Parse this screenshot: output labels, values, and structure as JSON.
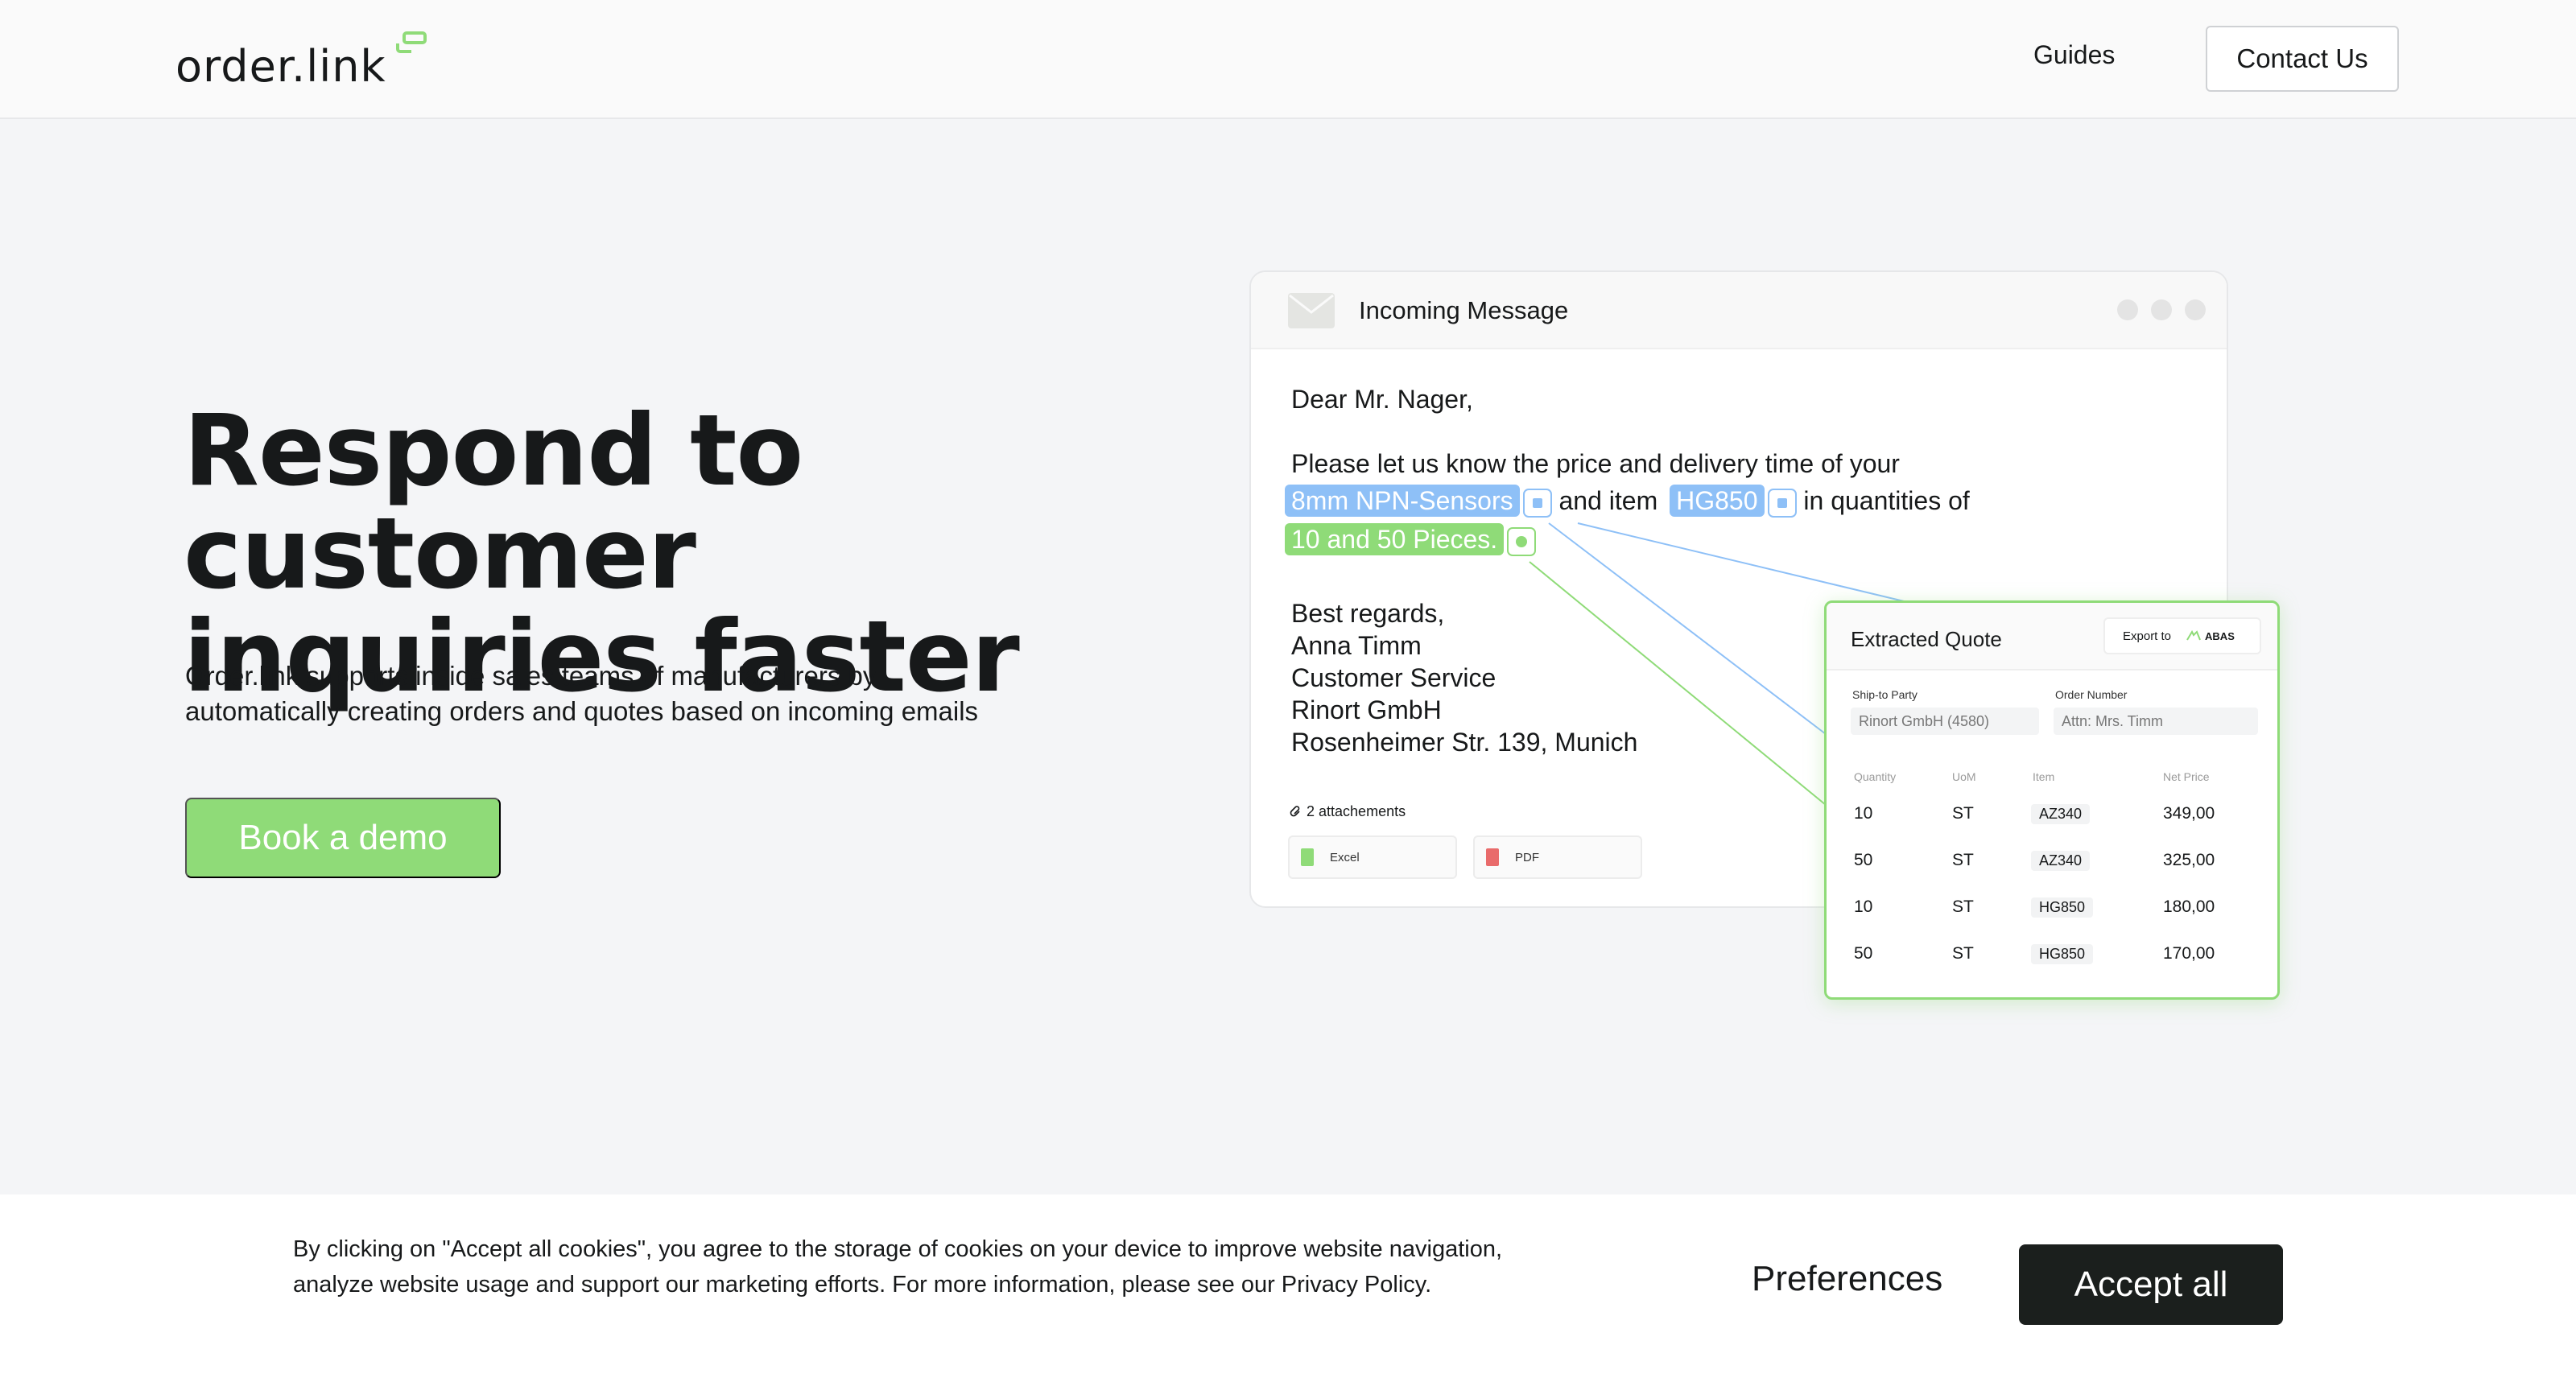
{
  "header": {
    "logo_text": "order.link",
    "nav_guides": "Guides",
    "nav_contact": "Contact Us"
  },
  "hero": {
    "title_line1": "Respond to customer",
    "title_line2": "inquiries faster",
    "subtitle_line1": "Order.link supports inside sales teams of manufacturers by",
    "subtitle_line2": "automatically creating orders and quotes based on incoming emails",
    "cta": "Book a demo"
  },
  "message": {
    "title": "Incoming Message",
    "greeting": "Dear Mr. Nager,",
    "body_line1": "Please let us know the price and delivery time of your",
    "tag1": "8mm NPN-Sensors",
    "and_item": "and item",
    "tag2": "HG850",
    "in_quantities": "in quantities of",
    "tag3": "10 and 50 Pieces.",
    "sign_lines": [
      "Best regards,",
      "Anna Timm",
      "Customer Service",
      "Rinort GmbH",
      "Rosenheimer Str. 139, Munich"
    ],
    "attachments_label": "2 attachements",
    "attachments": [
      "Excel",
      "PDF"
    ]
  },
  "quote": {
    "title": "Extracted Quote",
    "export_label": "Export to",
    "export_target": "ABAS",
    "ship_label": "Ship-to Party",
    "ship_value": "Rinort GmbH (4580)",
    "order_label": "Order Number",
    "order_value": "Attn: Mrs. Timm",
    "columns": [
      "Quantity",
      "UoM",
      "Item",
      "Net Price"
    ],
    "rows": [
      [
        "10",
        "ST",
        "AZ340",
        "349,00"
      ],
      [
        "50",
        "ST",
        "AZ340",
        "325,00"
      ],
      [
        "10",
        "ST",
        "HG850",
        "180,00"
      ],
      [
        "50",
        "ST",
        "HG850",
        "170,00"
      ]
    ]
  },
  "cookie": {
    "text": "By clicking on \"Accept all cookies\", you agree to the storage of cookies on your device to improve website navigation, analyze website usage and support our marketing efforts. For more information, please see our Privacy Policy.",
    "preferences": "Preferences",
    "accept": "Accept all"
  },
  "colors": {
    "accent_green": "#8fdb78",
    "accent_blue": "#8ec0f7",
    "dark": "#1b1f1d"
  }
}
